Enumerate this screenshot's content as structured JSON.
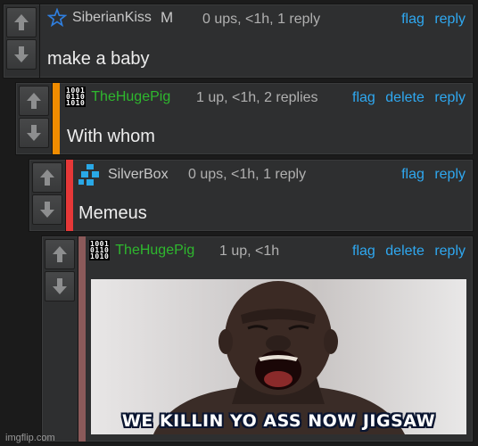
{
  "comments": [
    {
      "user": "SiberianKiss",
      "badge": "M",
      "meta": "0 ups, <1h, 1 reply",
      "actions": [
        "flag",
        "reply"
      ],
      "text": "make a baby",
      "avatar_icon": "star-icon"
    },
    {
      "user": "TheHugePig",
      "meta": "1 up, <1h, 2 replies",
      "actions": [
        "flag",
        "delete",
        "reply"
      ],
      "text": "With whom",
      "avatar_icon": "binary-avatar-icon",
      "stripe_color": "#f08c00"
    },
    {
      "user": "SilverBox",
      "meta": "0 ups, <1h, 1 reply",
      "actions": [
        "flag",
        "reply"
      ],
      "text": "Memeus",
      "avatar_icon": "blue-blocks-avatar-icon",
      "stripe_color": "#e63838"
    },
    {
      "user": "TheHugePig",
      "meta": "1 up, <1h",
      "actions": [
        "flag",
        "delete",
        "reply"
      ],
      "text": "",
      "avatar_icon": "binary-avatar-icon",
      "stripe_color": "#8b5a5a",
      "image_caption": "WE KILLIN YO ASS NOW JIGSAW"
    }
  ],
  "avatar_binary": [
    "1001",
    "0110",
    "1010"
  ],
  "watermark": "imgflip.com",
  "colors": {
    "link": "#2fa8f0",
    "username_default": "#c7c7c7",
    "username_hugepig": "#2eb82e"
  }
}
